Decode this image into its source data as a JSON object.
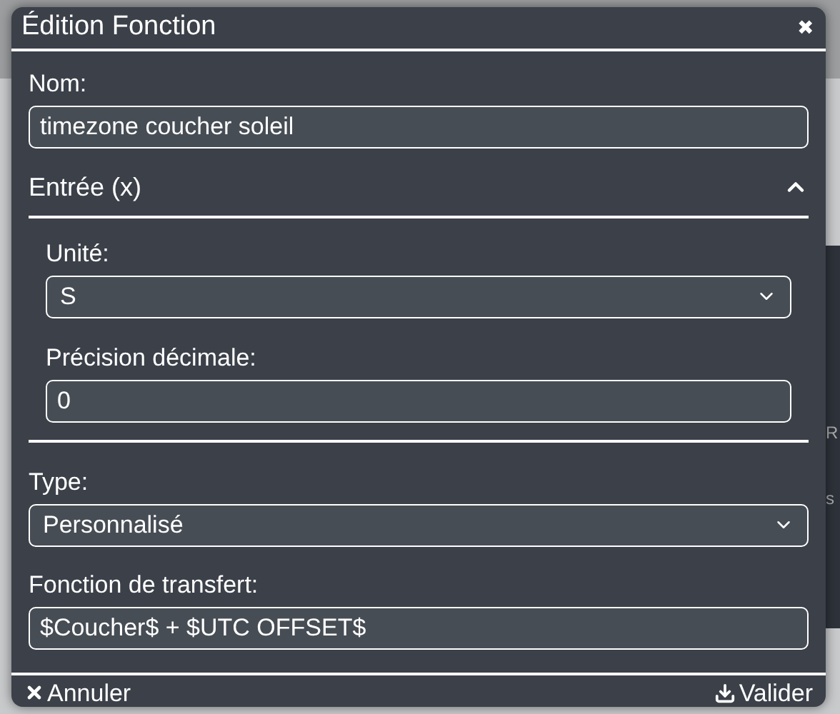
{
  "dialog": {
    "title": "Édition Fonction",
    "close": "✖"
  },
  "name_field": {
    "label": "Nom:",
    "value": "timezone coucher soleil"
  },
  "input_section": {
    "title": "Entrée (x)",
    "expanded": true,
    "unit": {
      "label": "Unité:",
      "value": "S"
    },
    "precision": {
      "label": "Précision décimale:",
      "value": "0"
    }
  },
  "type_field": {
    "label": "Type:",
    "value": "Personnalisé"
  },
  "transfer_field": {
    "label": "Fonction de transfert:",
    "value": "$Coucher$ + $UTC OFFSET$"
  },
  "footer": {
    "cancel": "Annuler",
    "confirm": "Valider"
  },
  "background_fragments": [
    "R",
    "s"
  ]
}
